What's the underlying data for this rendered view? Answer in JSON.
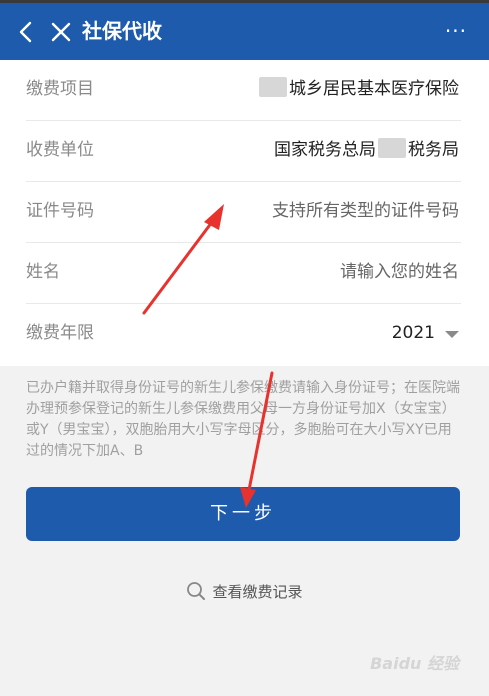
{
  "header": {
    "title": "社保代收",
    "more": "···",
    "back_icon": "chevron-left-icon",
    "close_icon": "close-icon",
    "bg_color": "#1e5bad"
  },
  "form": {
    "rows": [
      {
        "label": "缴费项目",
        "value": "城乡居民基本医疗保险",
        "redacted": true
      },
      {
        "label": "收费单位",
        "value_prefix": "国家税务总局",
        "value_suffix": "税务局"
      },
      {
        "label": "证件号码",
        "placeholder": "支持所有类型的证件号码"
      },
      {
        "label": "姓名",
        "placeholder": "请输入您的姓名"
      },
      {
        "label": "缴费年限",
        "value": "2021"
      }
    ]
  },
  "notice": "已办户籍并取得身份证号的新生儿参保缴费请输入身份证号；在医院端办理预参保登记的新生儿参保缴费用父母一方身份证号加X（女宝宝）或Y（男宝宝），双胞胎用大小写字母区分，多胞胎可在大小写XY已用过的情况下加A、B",
  "next_button": "下一步",
  "records_link": "查看缴费记录",
  "watermark": "Baidu 经验",
  "annotation_color": "#e8322d"
}
